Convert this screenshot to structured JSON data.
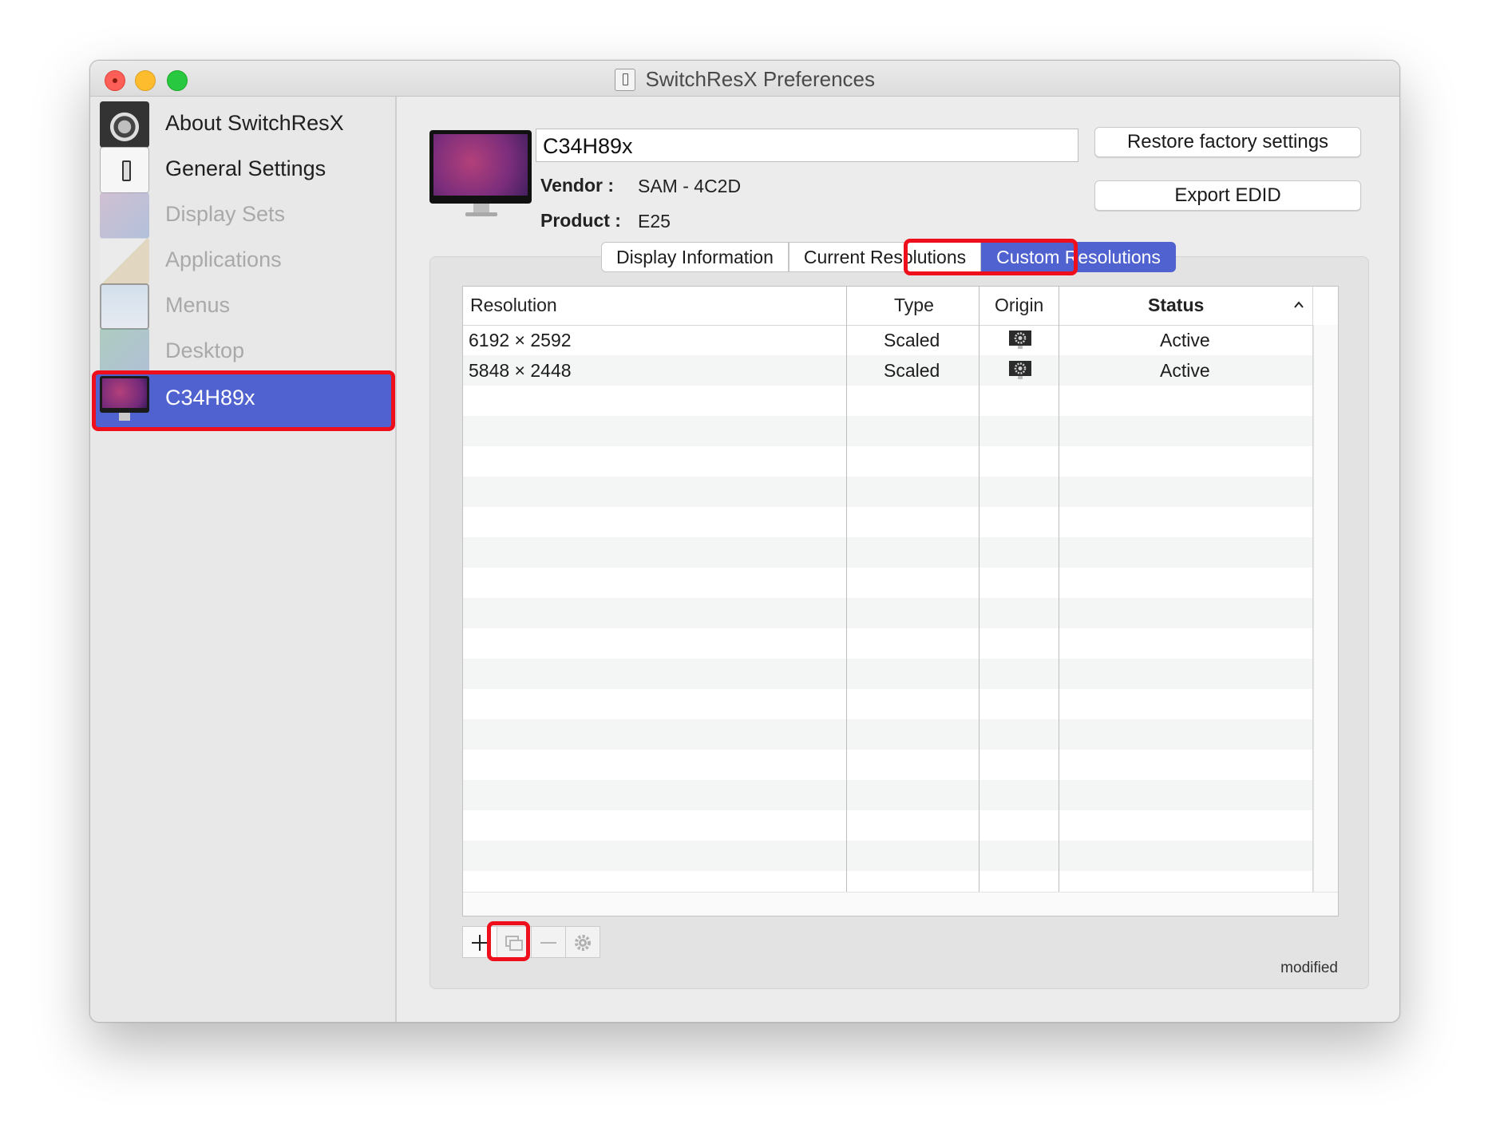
{
  "window": {
    "title": "SwitchResX Preferences"
  },
  "sidebar": {
    "items": [
      {
        "label": "About SwitchResX",
        "icon": "gear-icon",
        "enabled": true
      },
      {
        "label": "General Settings",
        "icon": "switch-icon",
        "enabled": true
      },
      {
        "label": "Display Sets",
        "icon": "display-sets-icon",
        "enabled": false
      },
      {
        "label": "Applications",
        "icon": "applications-icon",
        "enabled": false
      },
      {
        "label": "Menus",
        "icon": "menus-icon",
        "enabled": false
      },
      {
        "label": "Desktop",
        "icon": "desktop-icon",
        "enabled": false
      },
      {
        "label": "C34H89x",
        "icon": "monitor-icon",
        "enabled": true,
        "selected": true
      }
    ]
  },
  "display": {
    "name": "C34H89x",
    "vendor_label": "Vendor :",
    "vendor_value": "SAM - 4C2D",
    "product_label": "Product :",
    "product_value": "E25"
  },
  "buttons": {
    "restore": "Restore factory settings",
    "export": "Export EDID"
  },
  "tabs": [
    {
      "label": "Display Information",
      "active": false
    },
    {
      "label": "Current Resolutions",
      "active": false
    },
    {
      "label": "Custom Resolutions",
      "active": true
    }
  ],
  "table": {
    "columns": [
      "Resolution",
      "Type",
      "Origin",
      "Status"
    ],
    "sorted_column": "Status",
    "rows": [
      {
        "resolution": "6192 × 2592",
        "type": "Scaled",
        "origin_icon": "gear-monitor-icon",
        "status": "Active"
      },
      {
        "resolution": "5848 × 2448",
        "type": "Scaled",
        "origin_icon": "gear-monitor-icon",
        "status": "Active"
      }
    ]
  },
  "toolbar": {
    "buttons": [
      {
        "name": "add-button",
        "icon": "plus-icon",
        "enabled": true
      },
      {
        "name": "duplicate-button",
        "icon": "duplicate-icon",
        "enabled": false
      },
      {
        "name": "remove-button",
        "icon": "minus-icon",
        "enabled": false
      },
      {
        "name": "settings-button",
        "icon": "gear-icon",
        "enabled": false
      }
    ]
  },
  "status": {
    "text": "modified"
  },
  "colors": {
    "selection": "#4f62cf",
    "highlight": "#ee0e1c",
    "background": "#ececec"
  }
}
